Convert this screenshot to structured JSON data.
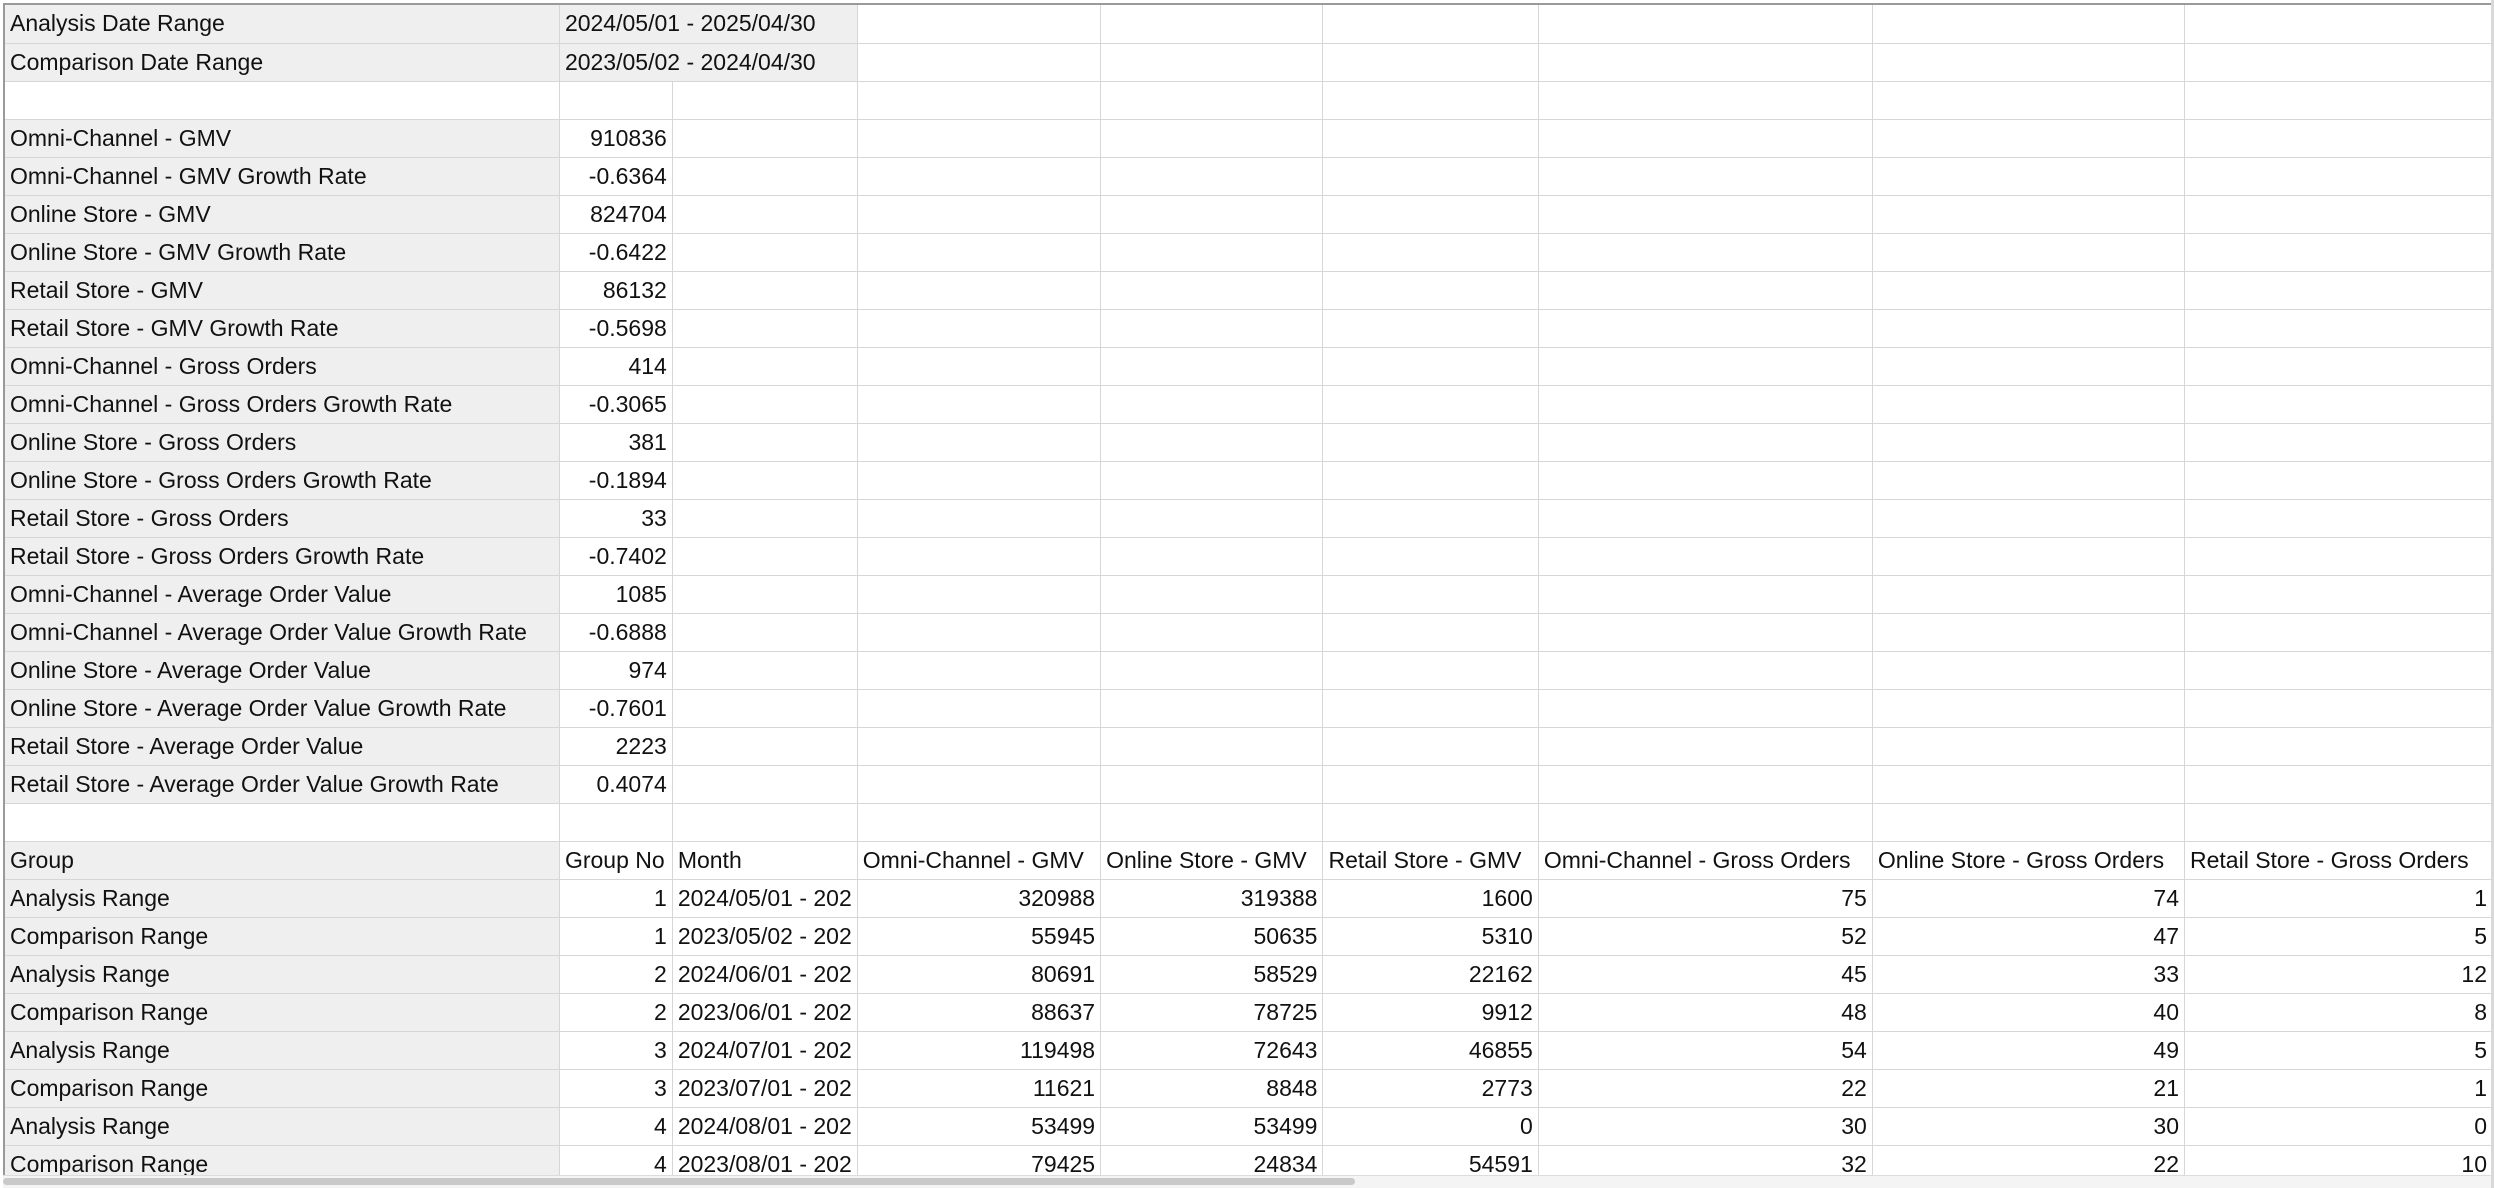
{
  "date_ranges": [
    {
      "label": "Analysis Date Range",
      "value": "2024/05/01 - 2025/04/30"
    },
    {
      "label": "Comparison Date Range",
      "value": "2023/05/02 - 2024/04/30"
    }
  ],
  "metrics": [
    {
      "label": "Omni-Channel - GMV",
      "value": "910836"
    },
    {
      "label": "Omni-Channel - GMV Growth Rate",
      "value": "-0.6364"
    },
    {
      "label": "Online Store - GMV",
      "value": "824704"
    },
    {
      "label": "Online Store - GMV Growth Rate",
      "value": "-0.6422"
    },
    {
      "label": "Retail Store - GMV",
      "value": "86132"
    },
    {
      "label": "Retail Store - GMV Growth Rate",
      "value": "-0.5698"
    },
    {
      "label": "Omni-Channel - Gross Orders",
      "value": "414"
    },
    {
      "label": "Omni-Channel - Gross Orders Growth Rate",
      "value": "-0.3065"
    },
    {
      "label": "Online Store - Gross Orders",
      "value": "381"
    },
    {
      "label": "Online Store - Gross Orders Growth Rate",
      "value": "-0.1894"
    },
    {
      "label": "Retail Store - Gross Orders",
      "value": "33"
    },
    {
      "label": "Retail Store - Gross Orders Growth Rate",
      "value": "-0.7402"
    },
    {
      "label": "Omni-Channel - Average Order Value",
      "value": "1085"
    },
    {
      "label": "Omni-Channel - Average Order Value Growth Rate",
      "value": "-0.6888"
    },
    {
      "label": "Online Store - Average Order Value",
      "value": "974"
    },
    {
      "label": "Online Store - Average Order Value Growth Rate",
      "value": "-0.7601"
    },
    {
      "label": "Retail Store - Average Order Value",
      "value": "2223"
    },
    {
      "label": "Retail Store - Average Order Value Growth Rate",
      "value": "0.4074"
    }
  ],
  "table": {
    "headers": [
      "Group",
      "Group No",
      "Month",
      "Omni-Channel - GMV",
      "Online Store - GMV",
      "Retail Store - GMV",
      "Omni-Channel - Gross Orders",
      "Online Store - Gross Orders",
      "Retail Store - Gross Orders"
    ],
    "rows": [
      [
        "Analysis Range",
        "1",
        "2024/05/01 - 202",
        "320988",
        "319388",
        "1600",
        "75",
        "74",
        "1"
      ],
      [
        "Comparison Range",
        "1",
        "2023/05/02 - 202",
        "55945",
        "50635",
        "5310",
        "52",
        "47",
        "5"
      ],
      [
        "Analysis Range",
        "2",
        "2024/06/01 - 202",
        "80691",
        "58529",
        "22162",
        "45",
        "33",
        "12"
      ],
      [
        "Comparison Range",
        "2",
        "2023/06/01 - 202",
        "88637",
        "78725",
        "9912",
        "48",
        "40",
        "8"
      ],
      [
        "Analysis Range",
        "3",
        "2024/07/01 - 202",
        "119498",
        "72643",
        "46855",
        "54",
        "49",
        "5"
      ],
      [
        "Comparison Range",
        "3",
        "2023/07/01 - 202",
        "11621",
        "8848",
        "2773",
        "22",
        "21",
        "1"
      ],
      [
        "Analysis Range",
        "4",
        "2024/08/01 - 202",
        "53499",
        "53499",
        "0",
        "30",
        "30",
        "0"
      ],
      [
        "Comparison Range",
        "4",
        "2023/08/01 - 202",
        "79425",
        "24834",
        "54591",
        "32",
        "22",
        "10"
      ]
    ]
  }
}
